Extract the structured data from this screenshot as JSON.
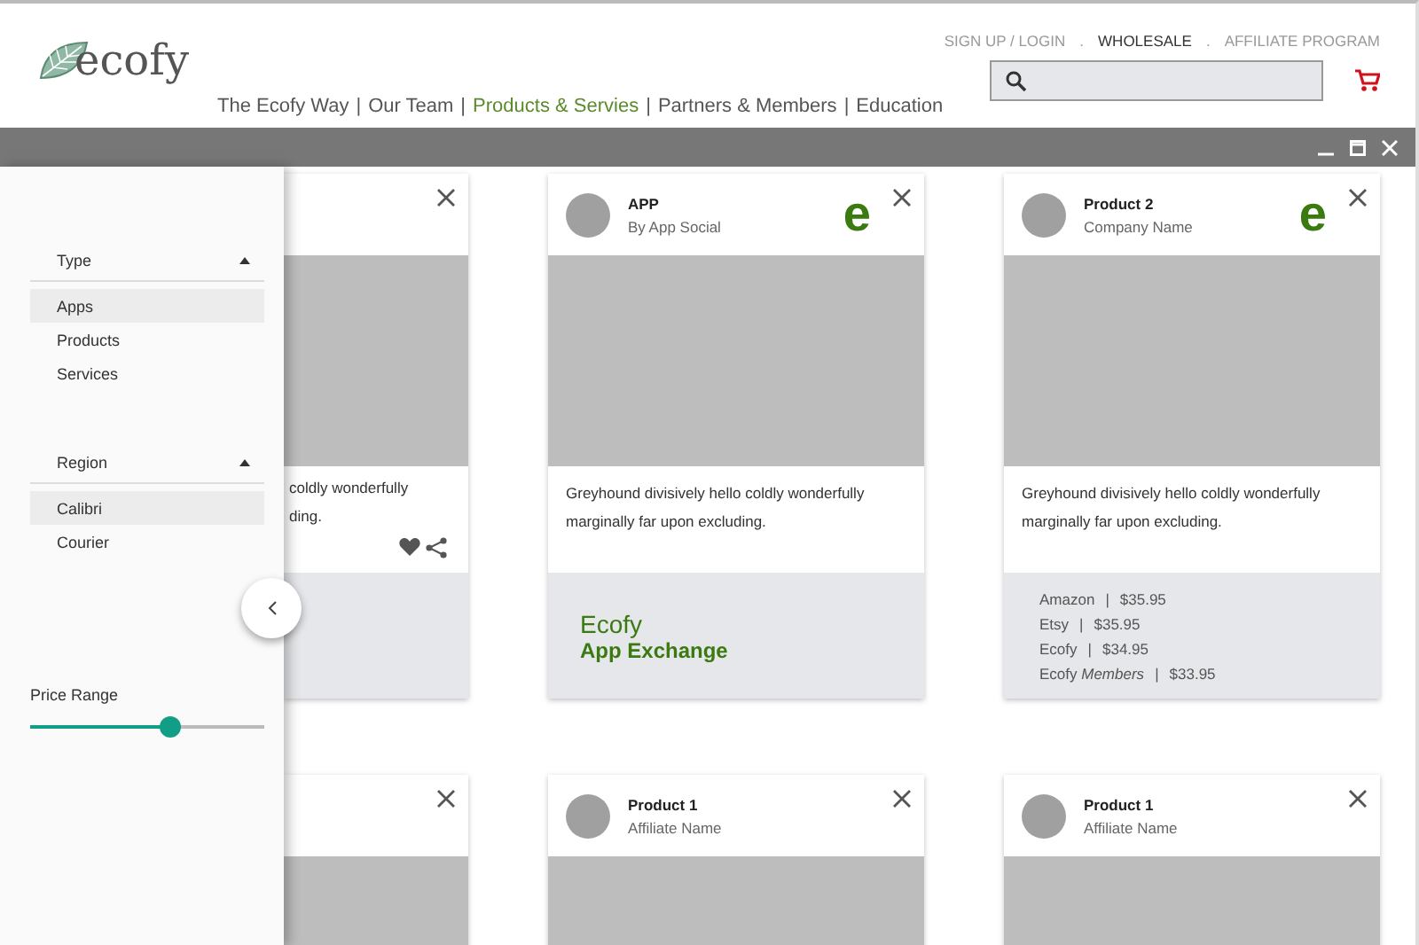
{
  "header": {
    "logo": "ecofy",
    "nav": [
      {
        "label": "The Ecofy Way",
        "selected": false,
        "separator": "|"
      },
      {
        "label": "Our Team",
        "selected": false,
        "separator": "|"
      },
      {
        "label": "Products & Servies",
        "selected": true,
        "separator": "|"
      },
      {
        "label": "Partners & Members",
        "selected": false,
        "separator": "|"
      },
      {
        "label": "Education",
        "selected": false
      }
    ],
    "top_links": [
      {
        "label": "SIGN UP / LOGIN",
        "selected": false,
        "separator": "."
      },
      {
        "label": "WHOLESALE",
        "selected": true,
        "separator": "."
      },
      {
        "label": "AFFILIATE PROGRAM",
        "selected": false
      }
    ]
  },
  "sidebar": {
    "filters": [
      {
        "title": "Type",
        "expanded": true,
        "options": [
          {
            "label": "Apps",
            "selected": true
          },
          {
            "label": "Products",
            "selected": false
          },
          {
            "label": "Services",
            "selected": false
          }
        ]
      },
      {
        "title": "Region",
        "expanded": true,
        "options": [
          {
            "label": "Calibri",
            "selected": true
          },
          {
            "label": "Courier",
            "selected": false
          }
        ]
      }
    ],
    "price_range": {
      "label": "Price Range",
      "level": 0.6
    }
  },
  "card_rows": [
    [
      {
        "kind": "partial",
        "description_lines": [
          "coldly wonderfully",
          "ding."
        ]
      },
      {
        "kind": "app",
        "title": "APP",
        "subtitle": "By App Social",
        "logo": "e",
        "description": "Greyhound divisively hello coldly wonderfully marginally far upon excluding.",
        "footer_title": "Ecofy",
        "footer_subtitle": "App Exchange"
      },
      {
        "kind": "listing",
        "title": "Product 2",
        "subtitle": "Company Name",
        "logo": "e",
        "description": "Greyhound divisively hello coldly wonderfully marginally far upon excluding.",
        "prices": [
          {
            "store": "Amazon",
            "separator": "|",
            "price": "$35.95"
          },
          {
            "store": "Etsy",
            "separator": "|",
            "price": "$35.95"
          },
          {
            "store": "Ecofy",
            "separator": "|",
            "price": "$34.95"
          },
          {
            "store": "Ecofy *Members*",
            "separator": "|",
            "price": "$33.95"
          }
        ]
      }
    ],
    [
      {
        "kind": "partial_top"
      },
      {
        "kind": "product",
        "title": "Product 1",
        "subtitle": "Affiliate Name"
      },
      {
        "kind": "product",
        "title": "Product 1",
        "subtitle": "Affiliate Name"
      }
    ]
  ]
}
